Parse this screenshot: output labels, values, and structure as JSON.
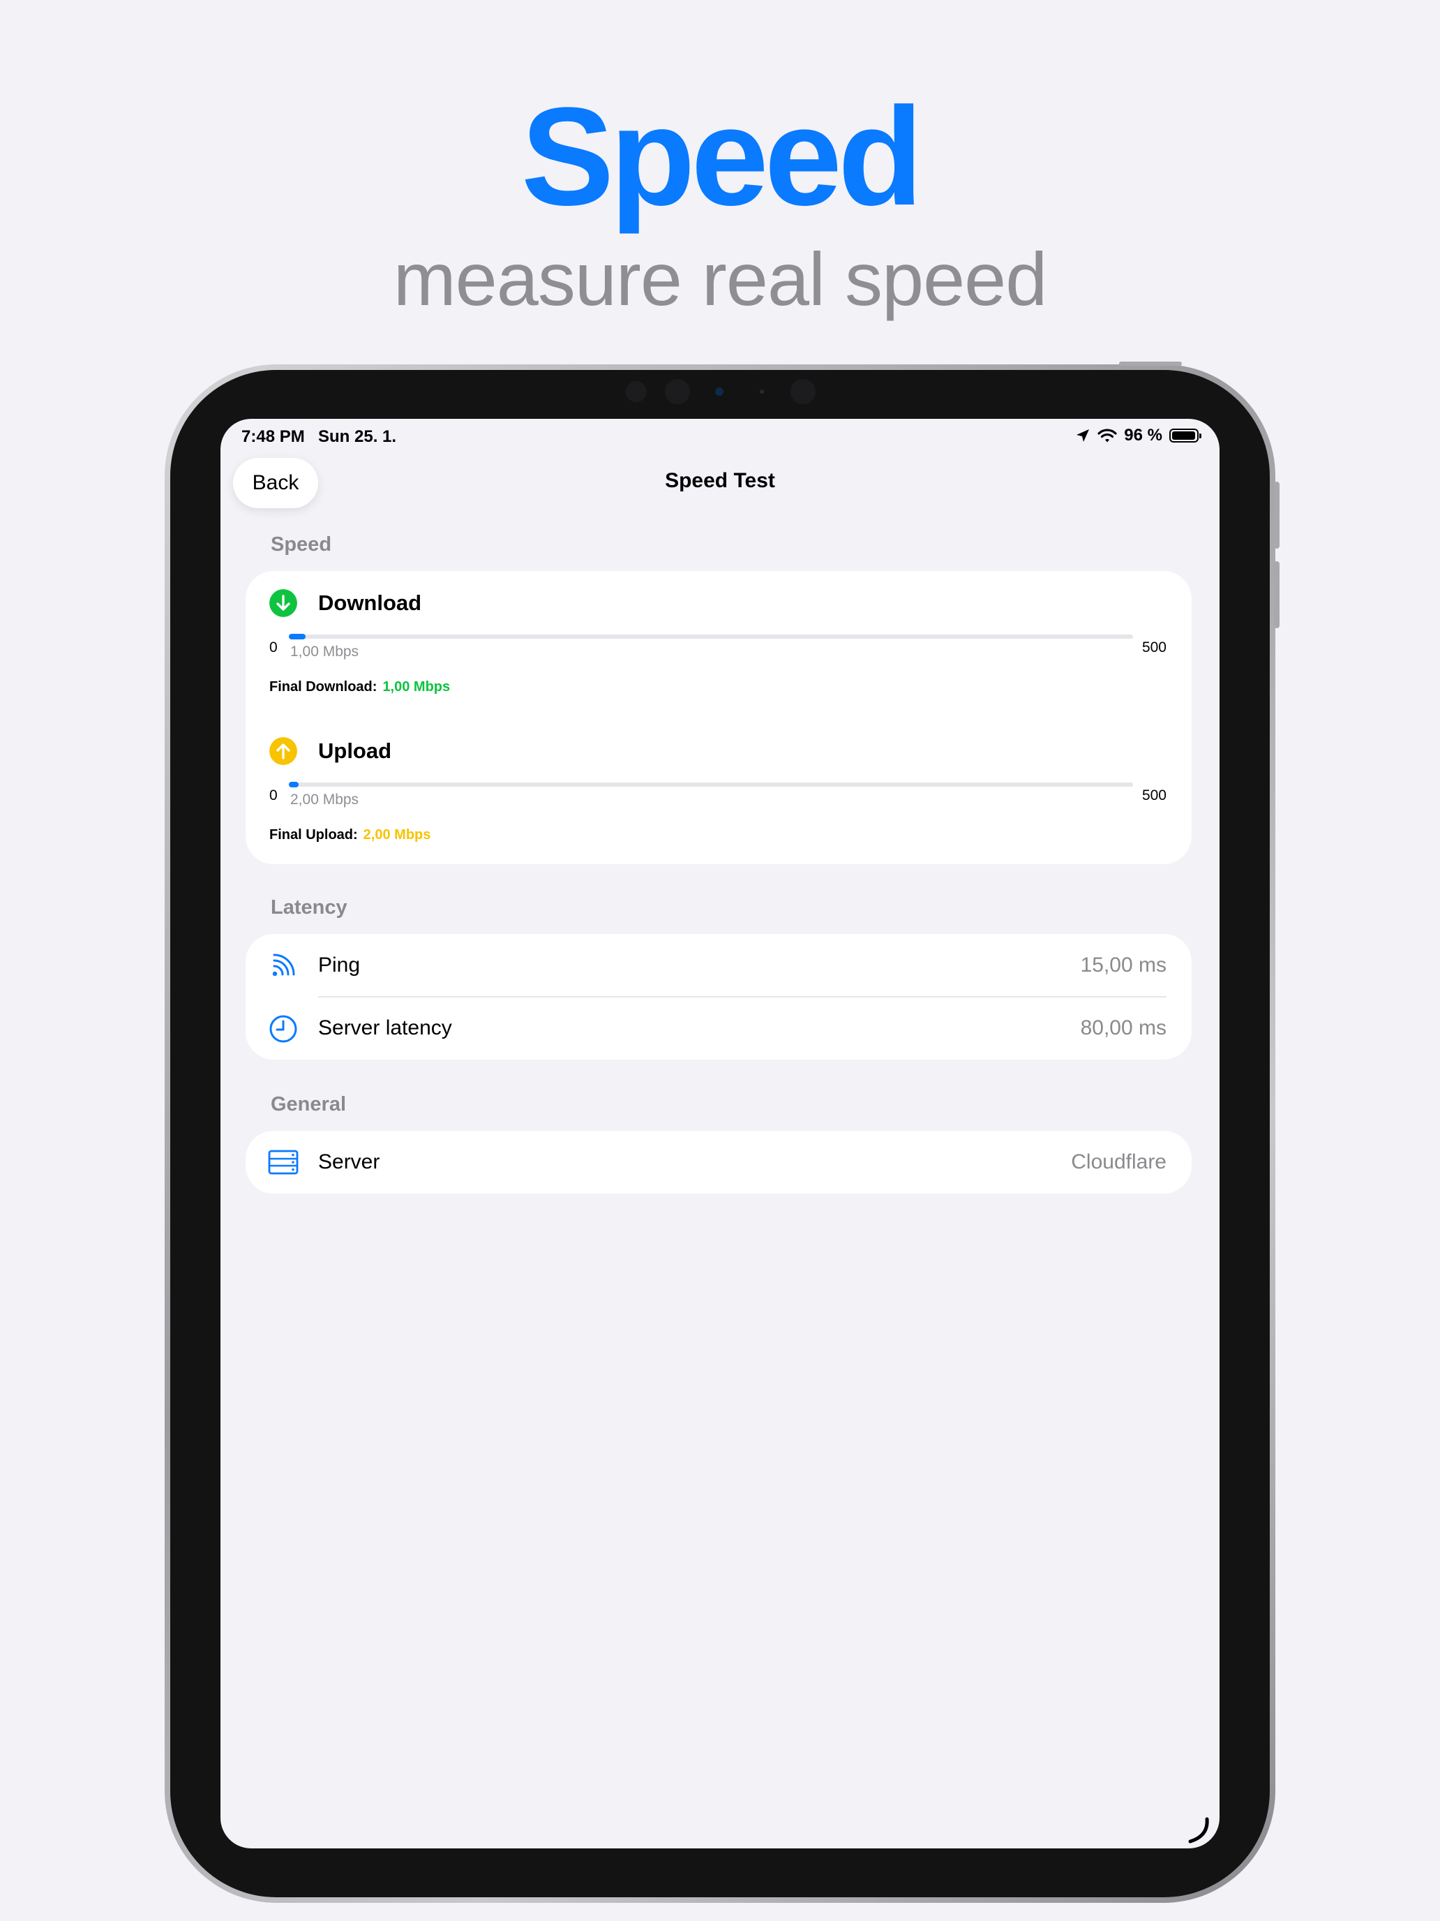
{
  "hero": {
    "title": "Speed",
    "subtitle": "measure real speed"
  },
  "status_bar": {
    "time": "7:48 PM",
    "date": "Sun 25. 1.",
    "battery": "96 %"
  },
  "nav": {
    "back_label": "Back",
    "title": "Speed Test"
  },
  "speed_section": {
    "header": "Speed",
    "download": {
      "title": "Download",
      "min_label": "0",
      "max_label": "500",
      "current_value": "1,00 Mbps",
      "progress": 0.02,
      "final_label": "Final Download:",
      "final_value": "1,00 Mbps"
    },
    "upload": {
      "title": "Upload",
      "min_label": "0",
      "max_label": "500",
      "current_value": "2,00 Mbps",
      "progress": 0.004,
      "final_label": "Final Upload:",
      "final_value": "2,00 Mbps"
    }
  },
  "latency_section": {
    "header": "Latency",
    "rows": [
      {
        "label": "Ping",
        "value": "15,00 ms",
        "icon": "wifi-signal-icon"
      },
      {
        "label": "Server latency",
        "value": "80,00 ms",
        "icon": "clock-icon"
      }
    ]
  },
  "general_section": {
    "header": "General",
    "rows": [
      {
        "label": "Server",
        "value": "Cloudflare",
        "icon": "server-icon"
      }
    ]
  },
  "colors": {
    "accent": "#0a7aff",
    "download": "#0ec33f",
    "upload": "#f8c300",
    "secondary_text": "#8a8a8e",
    "background": "#f2f2f7"
  }
}
